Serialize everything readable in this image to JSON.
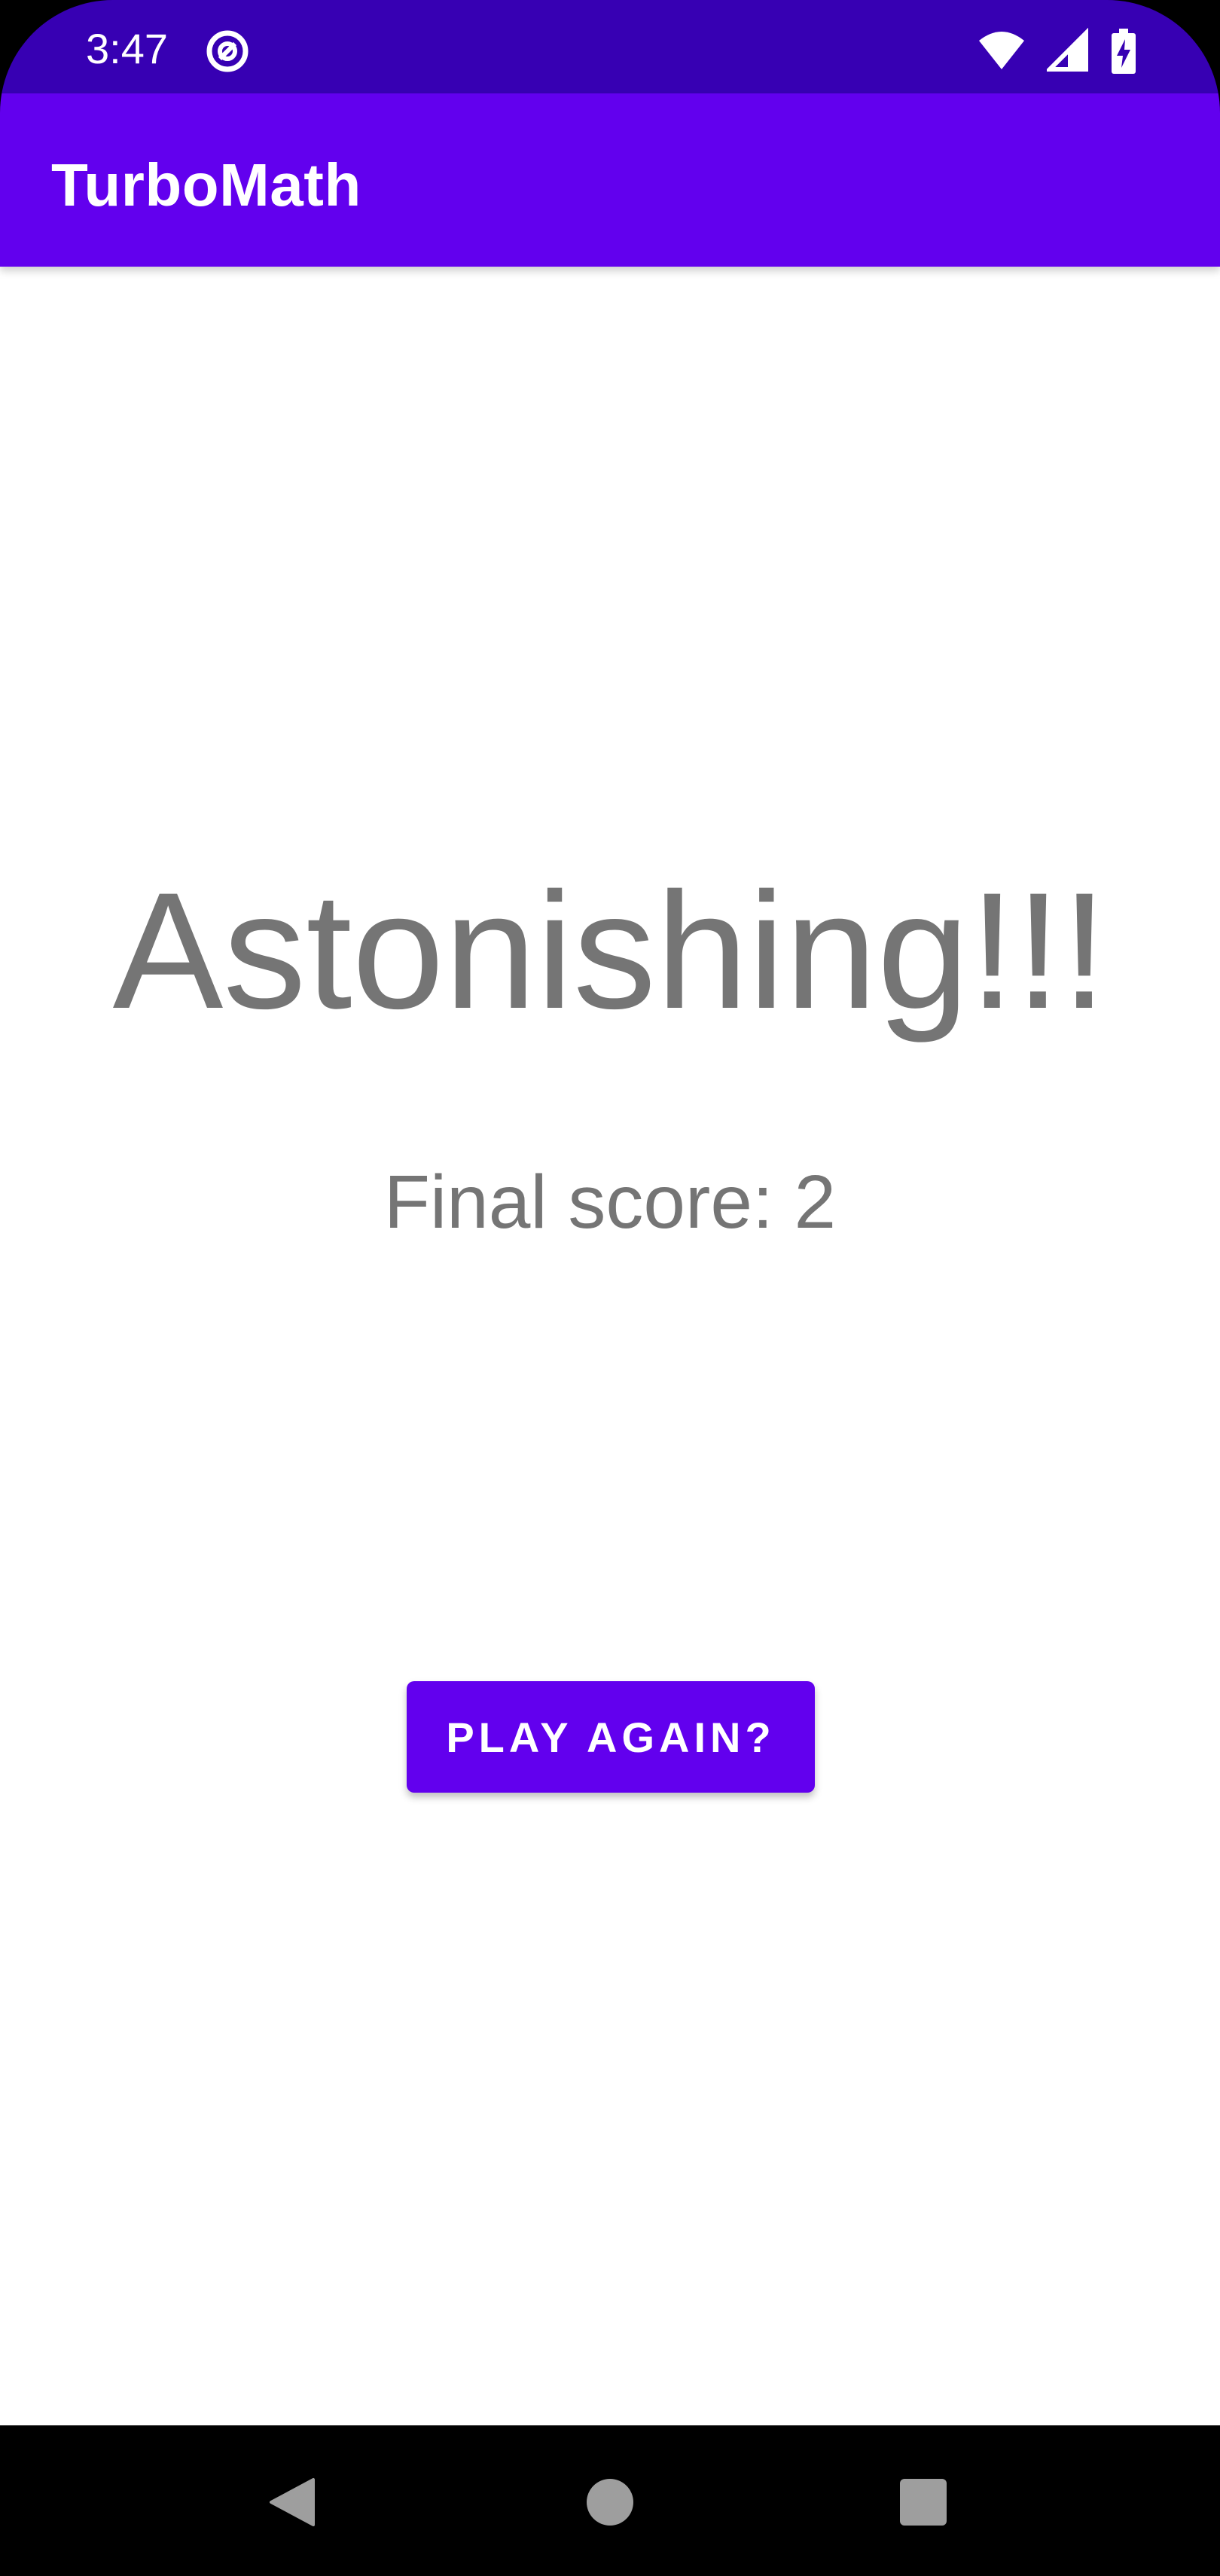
{
  "status_bar": {
    "time": "3:47",
    "icons": [
      "data-saver-icon",
      "wifi-icon",
      "cell-signal-icon",
      "battery-charging-icon"
    ]
  },
  "app_bar": {
    "title": "TurboMath",
    "color": "#6200EE"
  },
  "main": {
    "headline": "Astonishing!!!",
    "score_text": "Final score: 2",
    "play_again_label": "PLAY AGAIN?"
  },
  "nav_bar": {
    "icons": [
      "back-icon",
      "home-icon",
      "recents-icon"
    ]
  },
  "colors": {
    "status_bar": "#3700B3",
    "accent": "#6200EE",
    "text_secondary": "#757575"
  }
}
